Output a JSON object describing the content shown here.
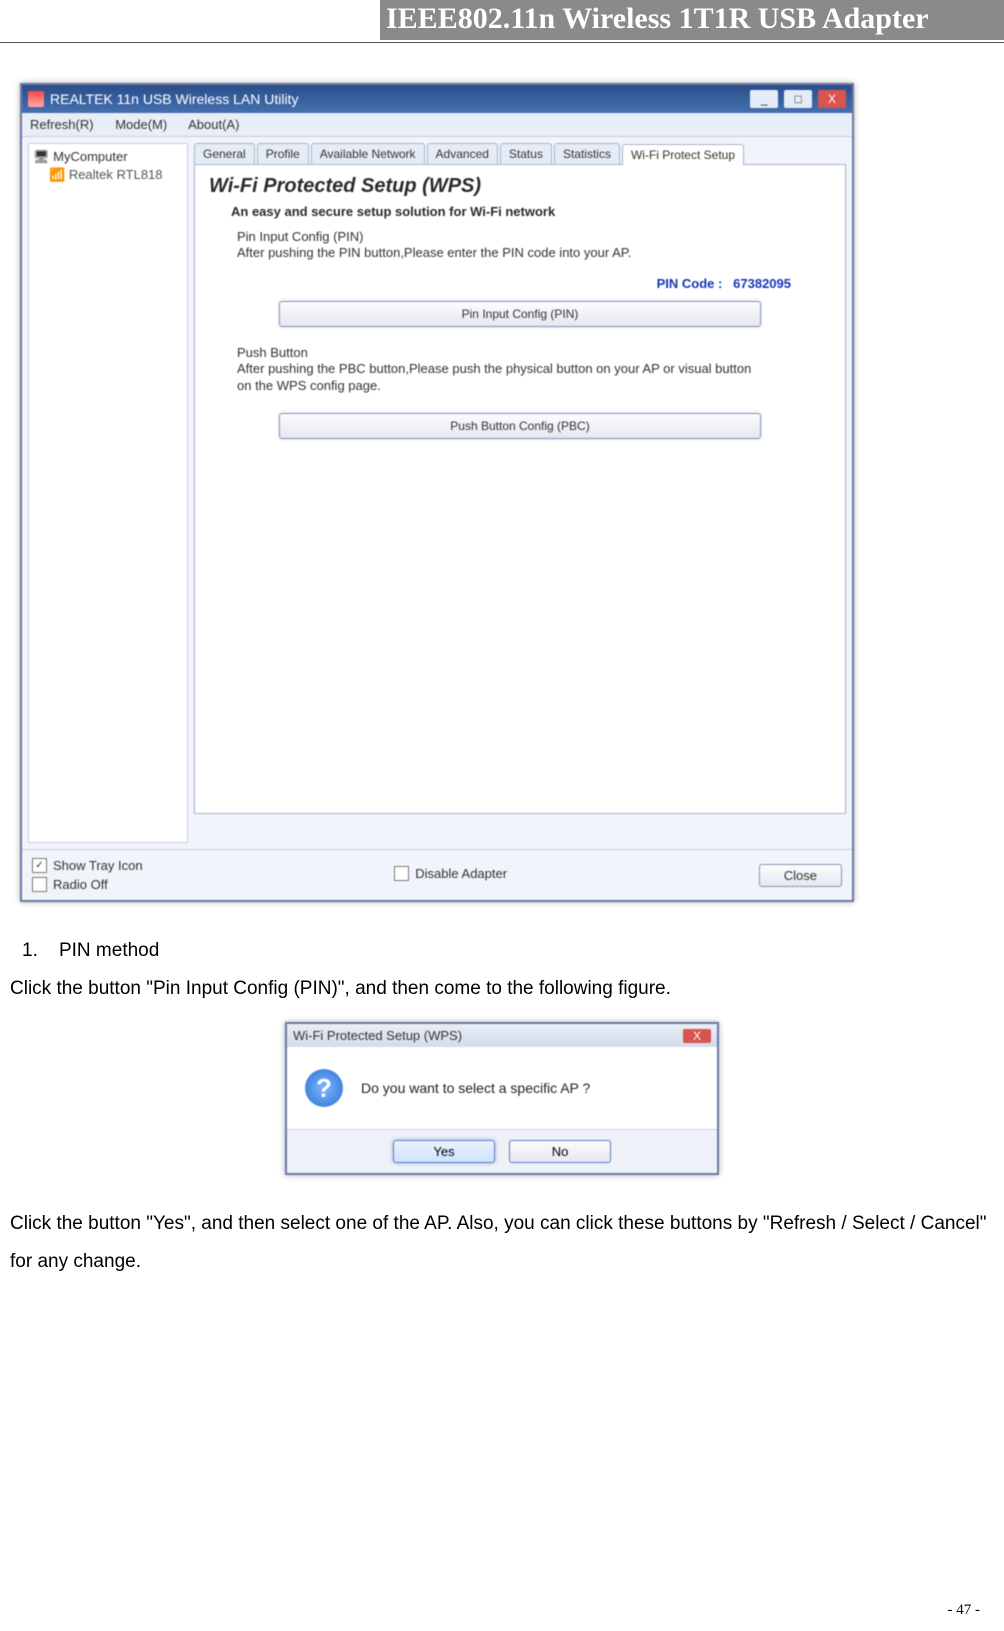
{
  "header": {
    "title": "IEEE802.11n Wireless 1T1R USB Adapter"
  },
  "utility_window": {
    "title": "REALTEK 11n USB Wireless LAN Utility",
    "menu": [
      "Refresh(R)",
      "Mode(M)",
      "About(A)"
    ],
    "tree": {
      "root": "MyComputer",
      "child": "Realtek RTL818"
    },
    "tabs": [
      "General",
      "Profile",
      "Available Network",
      "Advanced",
      "Status",
      "Statistics",
      "Wi-Fi Protect Setup"
    ],
    "active_tab_index": 6,
    "wps": {
      "heading": "Wi-Fi Protected Setup (WPS)",
      "subheading": "An easy and secure setup solution for Wi-Fi network",
      "pin_section_label": "Pin Input Config (PIN)",
      "pin_section_desc": "After pushing the PIN button,Please enter the PIN code into your AP.",
      "pin_code_label": "PIN Code :",
      "pin_code_value": "67382095",
      "pin_button": "Pin Input Config (PIN)",
      "push_section_label": "Push Button",
      "push_section_desc": "After pushing the PBC button,Please push the physical button on your AP or visual button on the WPS config page.",
      "push_button": "Push Button Config (PBC)"
    },
    "bottom": {
      "show_tray": "Show Tray Icon",
      "show_tray_checked": true,
      "radio_off": "Radio Off",
      "radio_off_checked": false,
      "disable_adapter": "Disable Adapter",
      "disable_adapter_checked": false,
      "close": "Close"
    },
    "window_controls": {
      "min": "_",
      "max": "□",
      "close": "X"
    }
  },
  "instructions": {
    "step_num": "1.",
    "step_title": "PIN method",
    "line1": "Click the button \"Pin Input Config (PIN)\", and then come to the following figure.",
    "line2": "Click the button \"Yes\", and then select one of the AP. Also, you can click these buttons by \"Refresh / Select / Cancel\" for any change."
  },
  "dialog": {
    "title": "Wi-Fi Protected Setup (WPS)",
    "message": "Do you want to select a specific AP ?",
    "yes": "Yes",
    "no": "No",
    "close_glyph": "X",
    "q_glyph": "?"
  },
  "footer": {
    "page_number": "- 47 -"
  }
}
